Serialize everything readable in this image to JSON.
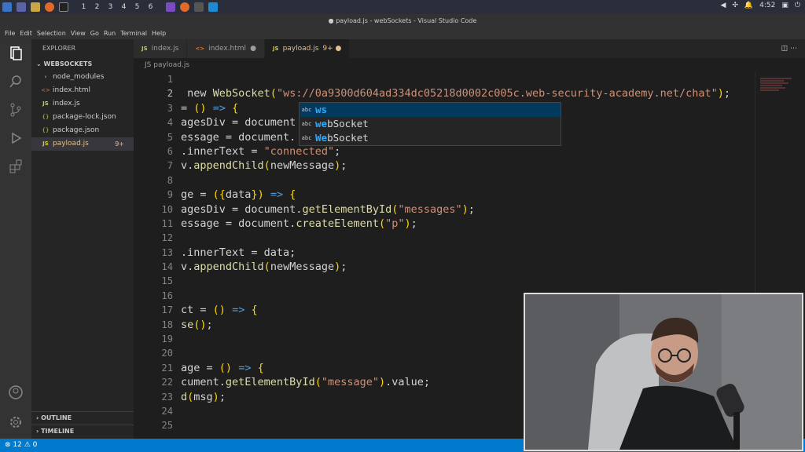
{
  "taskbar": {
    "workspaces": [
      "1",
      "2",
      "3",
      "4",
      "5",
      "6"
    ],
    "time": "4:52"
  },
  "window_title": "● payload.js - webSockets - Visual Studio Code",
  "menu": [
    "File",
    "Edit",
    "Selection",
    "View",
    "Go",
    "Run",
    "Terminal",
    "Help"
  ],
  "sidebar": {
    "header": "EXPLORER",
    "project": "WEBSOCKETS",
    "files": [
      {
        "name": "node_modules",
        "icon": "›",
        "badge": ""
      },
      {
        "name": "index.html",
        "icon": "<>",
        "badge": ""
      },
      {
        "name": "index.js",
        "icon": "JS",
        "badge": ""
      },
      {
        "name": "package-lock.json",
        "icon": "{}",
        "badge": ""
      },
      {
        "name": "package.json",
        "icon": "{}",
        "badge": ""
      },
      {
        "name": "payload.js",
        "icon": "JS",
        "badge": "9+"
      }
    ],
    "outline": "OUTLINE",
    "timeline": "TIMELINE"
  },
  "tabs": [
    {
      "icon": "JS",
      "label": "index.js",
      "suffix": ""
    },
    {
      "icon": "<>",
      "label": "index.html",
      "suffix": "●"
    },
    {
      "icon": "JS",
      "label": "payload.js",
      "suffix": "9+ ●"
    }
  ],
  "breadcrumb": "JS payload.js",
  "line_numbers": [
    "1",
    "2",
    "3",
    "4",
    "5",
    "6",
    "7",
    "8",
    "9",
    "10",
    "11",
    "12",
    "13",
    "14",
    "15",
    "16",
    "17",
    "18",
    "19",
    "20",
    "21",
    "22",
    "23",
    "24",
    "25"
  ],
  "code_lines": [
    "",
    " new WebSocket(\"ws://0a9300d604ad334dc05218d0002c005c.web-security-academy.net/chat\");",
    "= () => {",
    "agesDiv = document",
    "essage = document.",
    ".innerText = \"connected\";",
    "v.appendChild(newMessage);",
    "",
    "ge = ({data}) => {",
    "agesDiv = document.getElementById(\"messages\");",
    "essage = document.createElement(\"p\");",
    "",
    ".innerText = data;",
    "v.appendChild(newMessage);",
    "",
    "",
    "ct = () => {",
    "se();",
    "",
    "",
    "age = () => {",
    "cument.getElementById(\"message\").value;",
    "d(msg);",
    "",
    ""
  ],
  "suggestions": [
    {
      "kind": "abc",
      "match": "ws",
      "rest": ""
    },
    {
      "kind": "abc",
      "match": "we",
      "rest": "bSocket"
    },
    {
      "kind": "abc",
      "match": "We",
      "rest": "bSocket"
    }
  ],
  "status": {
    "errors": "12",
    "warnings": "0"
  },
  "colors": {
    "accent": "#007acc",
    "string": "#ce9178",
    "function": "#dcdcaa"
  }
}
